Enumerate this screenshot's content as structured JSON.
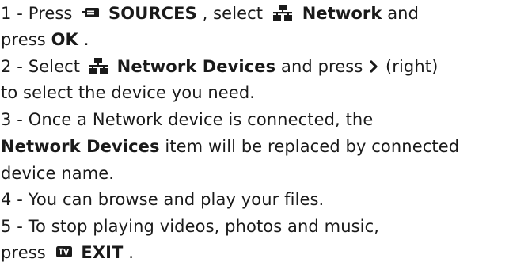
{
  "steps": [
    {
      "line1": {
        "prefix": "1 - Press ",
        "sources_label": "SOURCES",
        "mid": ", select ",
        "network_label": "Network",
        "suffix": " and"
      },
      "line2": {
        "prefix": "press ",
        "ok_label": "OK",
        "suffix": "."
      }
    },
    {
      "line1": {
        "prefix": "2 - Select ",
        "network_devices_label": "Network Devices",
        "mid": " and press ",
        "suffix": " (right)"
      },
      "line2": {
        "text": "to select the device you need."
      }
    },
    {
      "line1": {
        "text": "3 - Once a Network device is connected, the"
      },
      "line2": {
        "network_devices_label": "Network Devices",
        "suffix": " item will be replaced by connected"
      },
      "line3": {
        "text": "device name."
      }
    },
    {
      "line1": {
        "text": "4 - You can browse and play your files."
      }
    },
    {
      "line1": {
        "text": "5 - To stop playing videos, photos and music,"
      },
      "line2": {
        "prefix": "press ",
        "exit_label": "EXIT",
        "suffix": "."
      }
    }
  ],
  "icons": {
    "sources": "sources-icon",
    "network": "network-icon",
    "chevron": "chevron-right-icon",
    "tv": "tv-icon"
  }
}
